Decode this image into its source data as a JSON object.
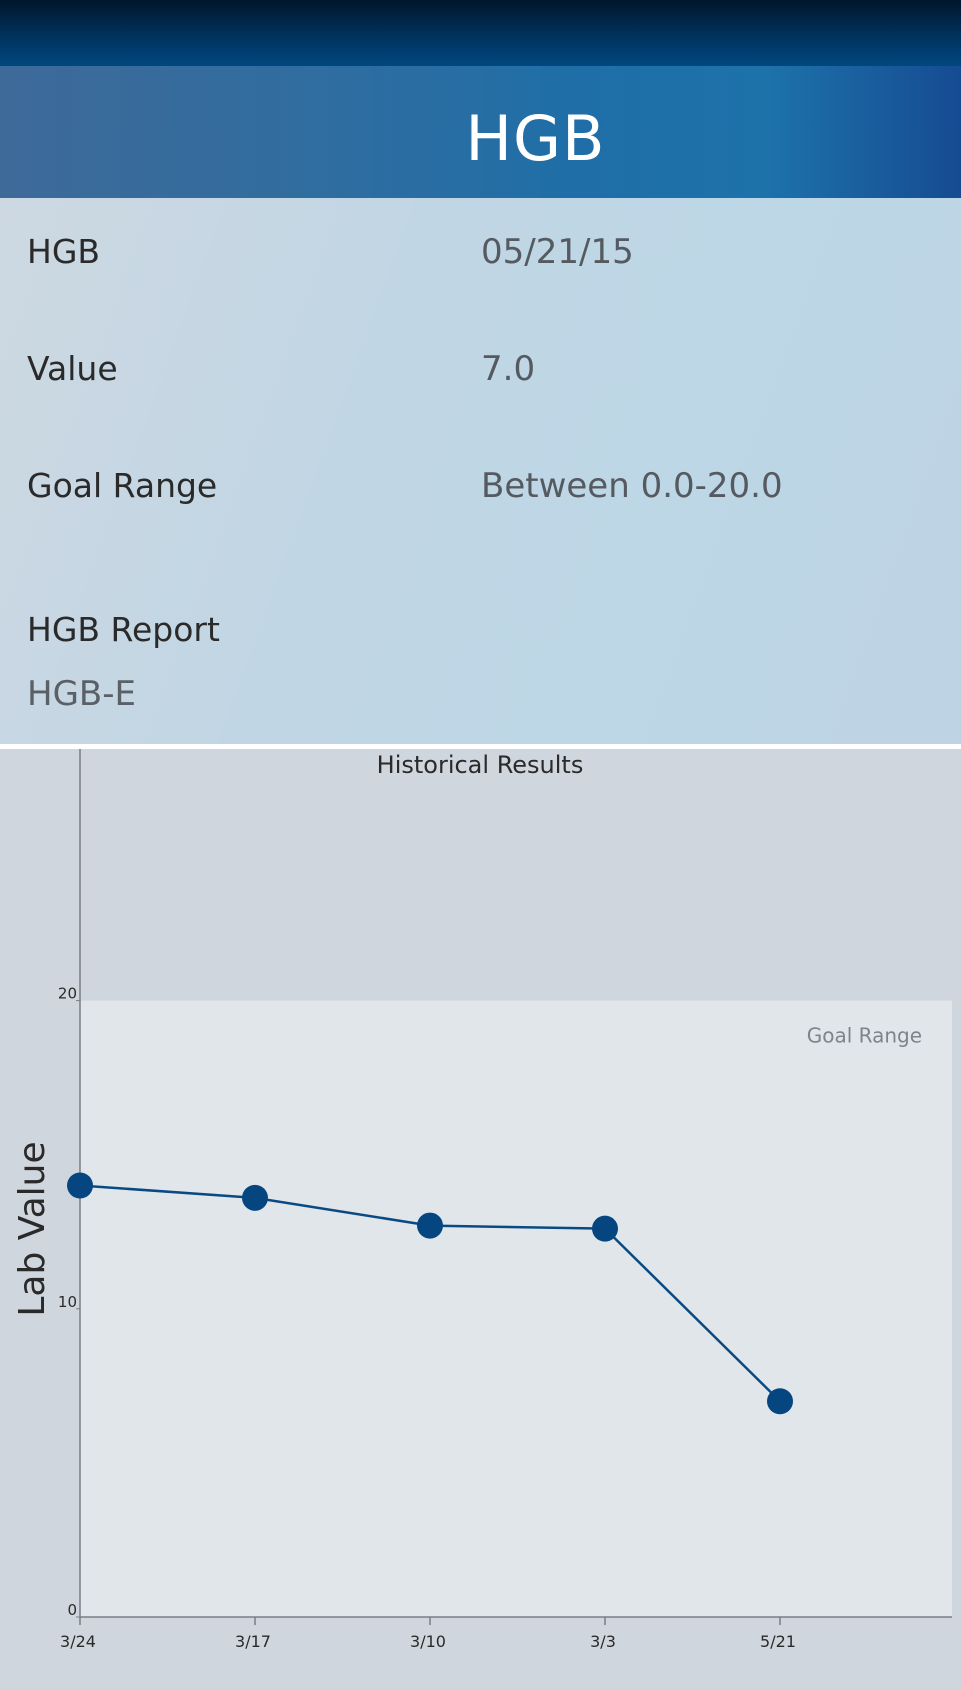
{
  "app_bar": {
    "title": "HGB"
  },
  "details": {
    "rows": [
      {
        "label": "HGB",
        "value": "05/21/15"
      },
      {
        "label": "Value",
        "value": "7.0"
      },
      {
        "label": "Goal Range",
        "value": "Between 0.0-20.0"
      }
    ],
    "report": {
      "label": "HGB Report",
      "value": "HGB-E"
    }
  },
  "chart_data": {
    "type": "line",
    "title": "Historical Results",
    "ylabel": "Lab Value",
    "xlabel": "",
    "categories": [
      "3/24",
      "3/17",
      "3/10",
      "3/3",
      "5/21"
    ],
    "values": [
      14.0,
      13.6,
      12.7,
      12.6,
      7.0
    ],
    "ylim": [
      0,
      28
    ],
    "yticks": [
      0,
      10,
      20
    ],
    "goal_range": {
      "label": "Goal Range",
      "min": 0,
      "max": 20
    },
    "colors": {
      "line": "#0a4a82",
      "point": "#064680",
      "goal_band": "#e1e6ea",
      "axis": "#7a7f84"
    }
  }
}
